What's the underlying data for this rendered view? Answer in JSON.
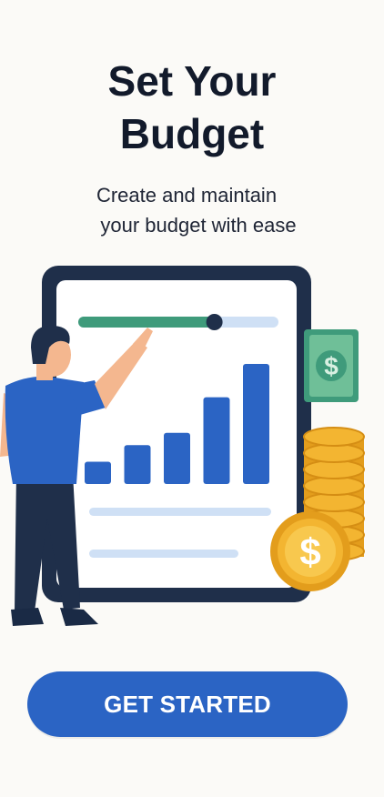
{
  "onboarding": {
    "title_line1": "Set Your",
    "title_line2": "Budget",
    "subtitle_line1": "Create and maintain",
    "subtitle_line2": "your budget with ease",
    "cta_label": "GET STARTED"
  },
  "illustration": {
    "slider_fill_fraction": 0.68,
    "bar_values": [
      1,
      1.75,
      2.3,
      3.9,
      5.4
    ],
    "currency_symbol": "$"
  },
  "colors": {
    "background": "#fbfaf7",
    "title": "#121a2b",
    "accent": "#2b64c4",
    "tablet_frame": "#1f2f4a",
    "slider_fill": "#3f9b7b",
    "coin": "#f3b531"
  }
}
